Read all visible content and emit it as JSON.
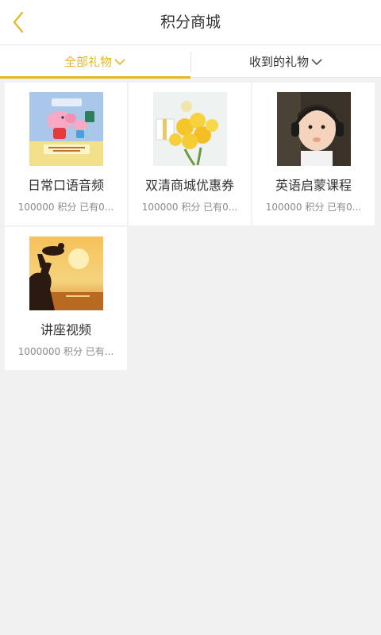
{
  "header": {
    "title": "积分商城",
    "back_icon": "back-chevron-icon"
  },
  "tabs": [
    {
      "label": "全部礼物",
      "active": true
    },
    {
      "label": "收到的礼物",
      "active": false
    }
  ],
  "colors": {
    "accent": "#e8b625",
    "background": "#f1f1f1",
    "card": "#ffffff",
    "text": "#333333",
    "muted": "#8a8a8a"
  },
  "gifts": [
    {
      "name": "日常口语音频",
      "meta": "100000 积分  已有0..."
    },
    {
      "name": "双清商城优惠券",
      "meta": "100000 积分  已有0..."
    },
    {
      "name": "英语启蒙课程",
      "meta": "100000 积分  已有0..."
    },
    {
      "name": "讲座视频",
      "meta": "1000000 积分  已有..."
    }
  ]
}
